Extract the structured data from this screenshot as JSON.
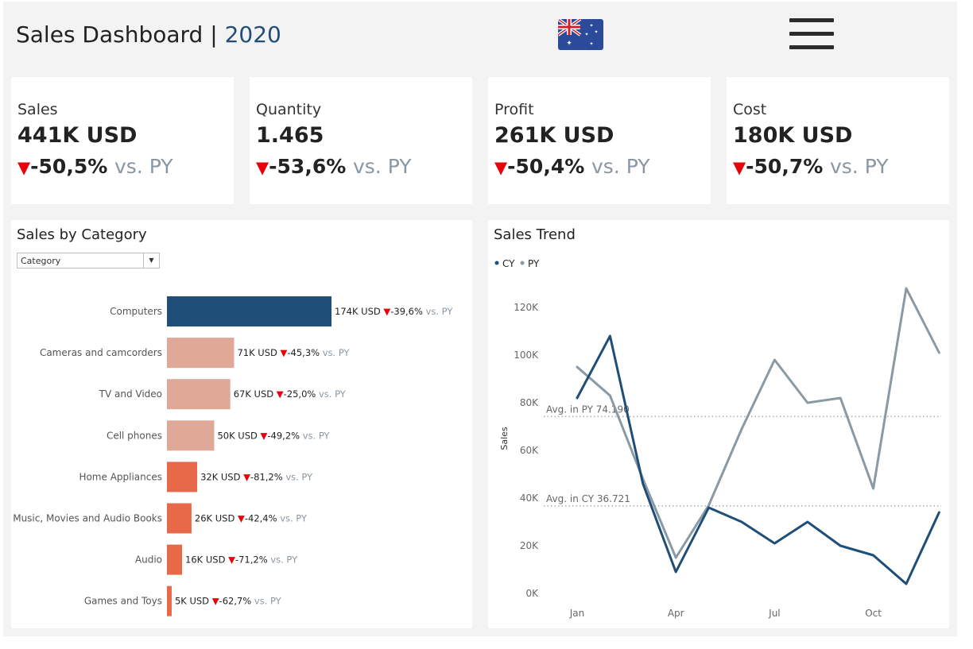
{
  "header": {
    "title": "Sales Dashboard",
    "separator": "|",
    "year": "2020",
    "flag_icon": "australia-flag-icon",
    "menu_icon": "hamburger-menu-icon"
  },
  "kpis": [
    {
      "label": "Sales",
      "value": "441K USD",
      "change": "-50,5%",
      "vs": "vs. PY"
    },
    {
      "label": "Quantity",
      "value": "1.465",
      "change": "-53,6%",
      "vs": "vs. PY"
    },
    {
      "label": "Profit",
      "value": "261K USD",
      "change": "-50,4%",
      "vs": "vs. PY"
    },
    {
      "label": "Cost",
      "value": "180K USD",
      "change": "-50,7%",
      "vs": "vs. PY"
    }
  ],
  "category_panel": {
    "title": "Sales by Category",
    "dropdown_value": "Category"
  },
  "trend_panel": {
    "title": "Sales Trend"
  },
  "colors": {
    "cy": "#1f4e79",
    "py": "#8a9aa5",
    "bar_top": "#1f4e79",
    "bar_mid": "#e0a896",
    "bar_low": "#e8694a",
    "down": "#e8000b"
  },
  "chart_data": [
    {
      "type": "bar",
      "orientation": "horizontal",
      "categories": [
        "Computers",
        "Cameras and camcorders",
        "TV and Video",
        "Cell phones",
        "Home Appliances",
        "Music, Movies and Audio Books",
        "Audio",
        "Games and Toys"
      ],
      "values": [
        174,
        71,
        67,
        50,
        32,
        26,
        16,
        5
      ],
      "value_labels": [
        "174K USD",
        "71K USD",
        "67K USD",
        "50K USD",
        "32K USD",
        "26K USD",
        "16K USD",
        "5K USD"
      ],
      "changes": [
        "-39,6%",
        "-45,3%",
        "-25,0%",
        "-49,2%",
        "-81,2%",
        "-42,4%",
        "-71,2%",
        "-62,7%"
      ],
      "vs_label": "vs. PY",
      "bar_color_groups": [
        "top",
        "mid",
        "mid",
        "mid",
        "low",
        "low",
        "low",
        "low"
      ]
    },
    {
      "type": "line",
      "x": [
        "Jan",
        "Feb",
        "Mar",
        "Apr",
        "May",
        "Jun",
        "Jul",
        "Aug",
        "Sep",
        "Oct",
        "Nov",
        "Dec"
      ],
      "x_tick_labels": [
        "Jan",
        "Apr",
        "Jul",
        "Oct"
      ],
      "ylabel": "Sales",
      "y_ticks": [
        0,
        20000,
        40000,
        60000,
        80000,
        100000,
        120000
      ],
      "y_tick_labels": [
        "0K",
        "20K",
        "40K",
        "60K",
        "80K",
        "100K",
        "120K"
      ],
      "ylim": [
        0,
        130000
      ],
      "legend": [
        {
          "name": "CY"
        },
        {
          "name": "PY"
        }
      ],
      "legend_position": "top-left",
      "series": [
        {
          "name": "CY",
          "values": [
            82000,
            108000,
            46000,
            9000,
            36000,
            30000,
            21000,
            30000,
            20000,
            16000,
            4000,
            34000
          ]
        },
        {
          "name": "PY",
          "values": [
            95000,
            83000,
            48000,
            15000,
            37000,
            69000,
            98000,
            80000,
            82000,
            44000,
            128000,
            101000
          ]
        }
      ],
      "reference_lines": [
        {
          "label": "Avg. in PY 74.190",
          "value": 74190
        },
        {
          "label": "Avg. in CY 36.721",
          "value": 36721
        }
      ]
    }
  ]
}
